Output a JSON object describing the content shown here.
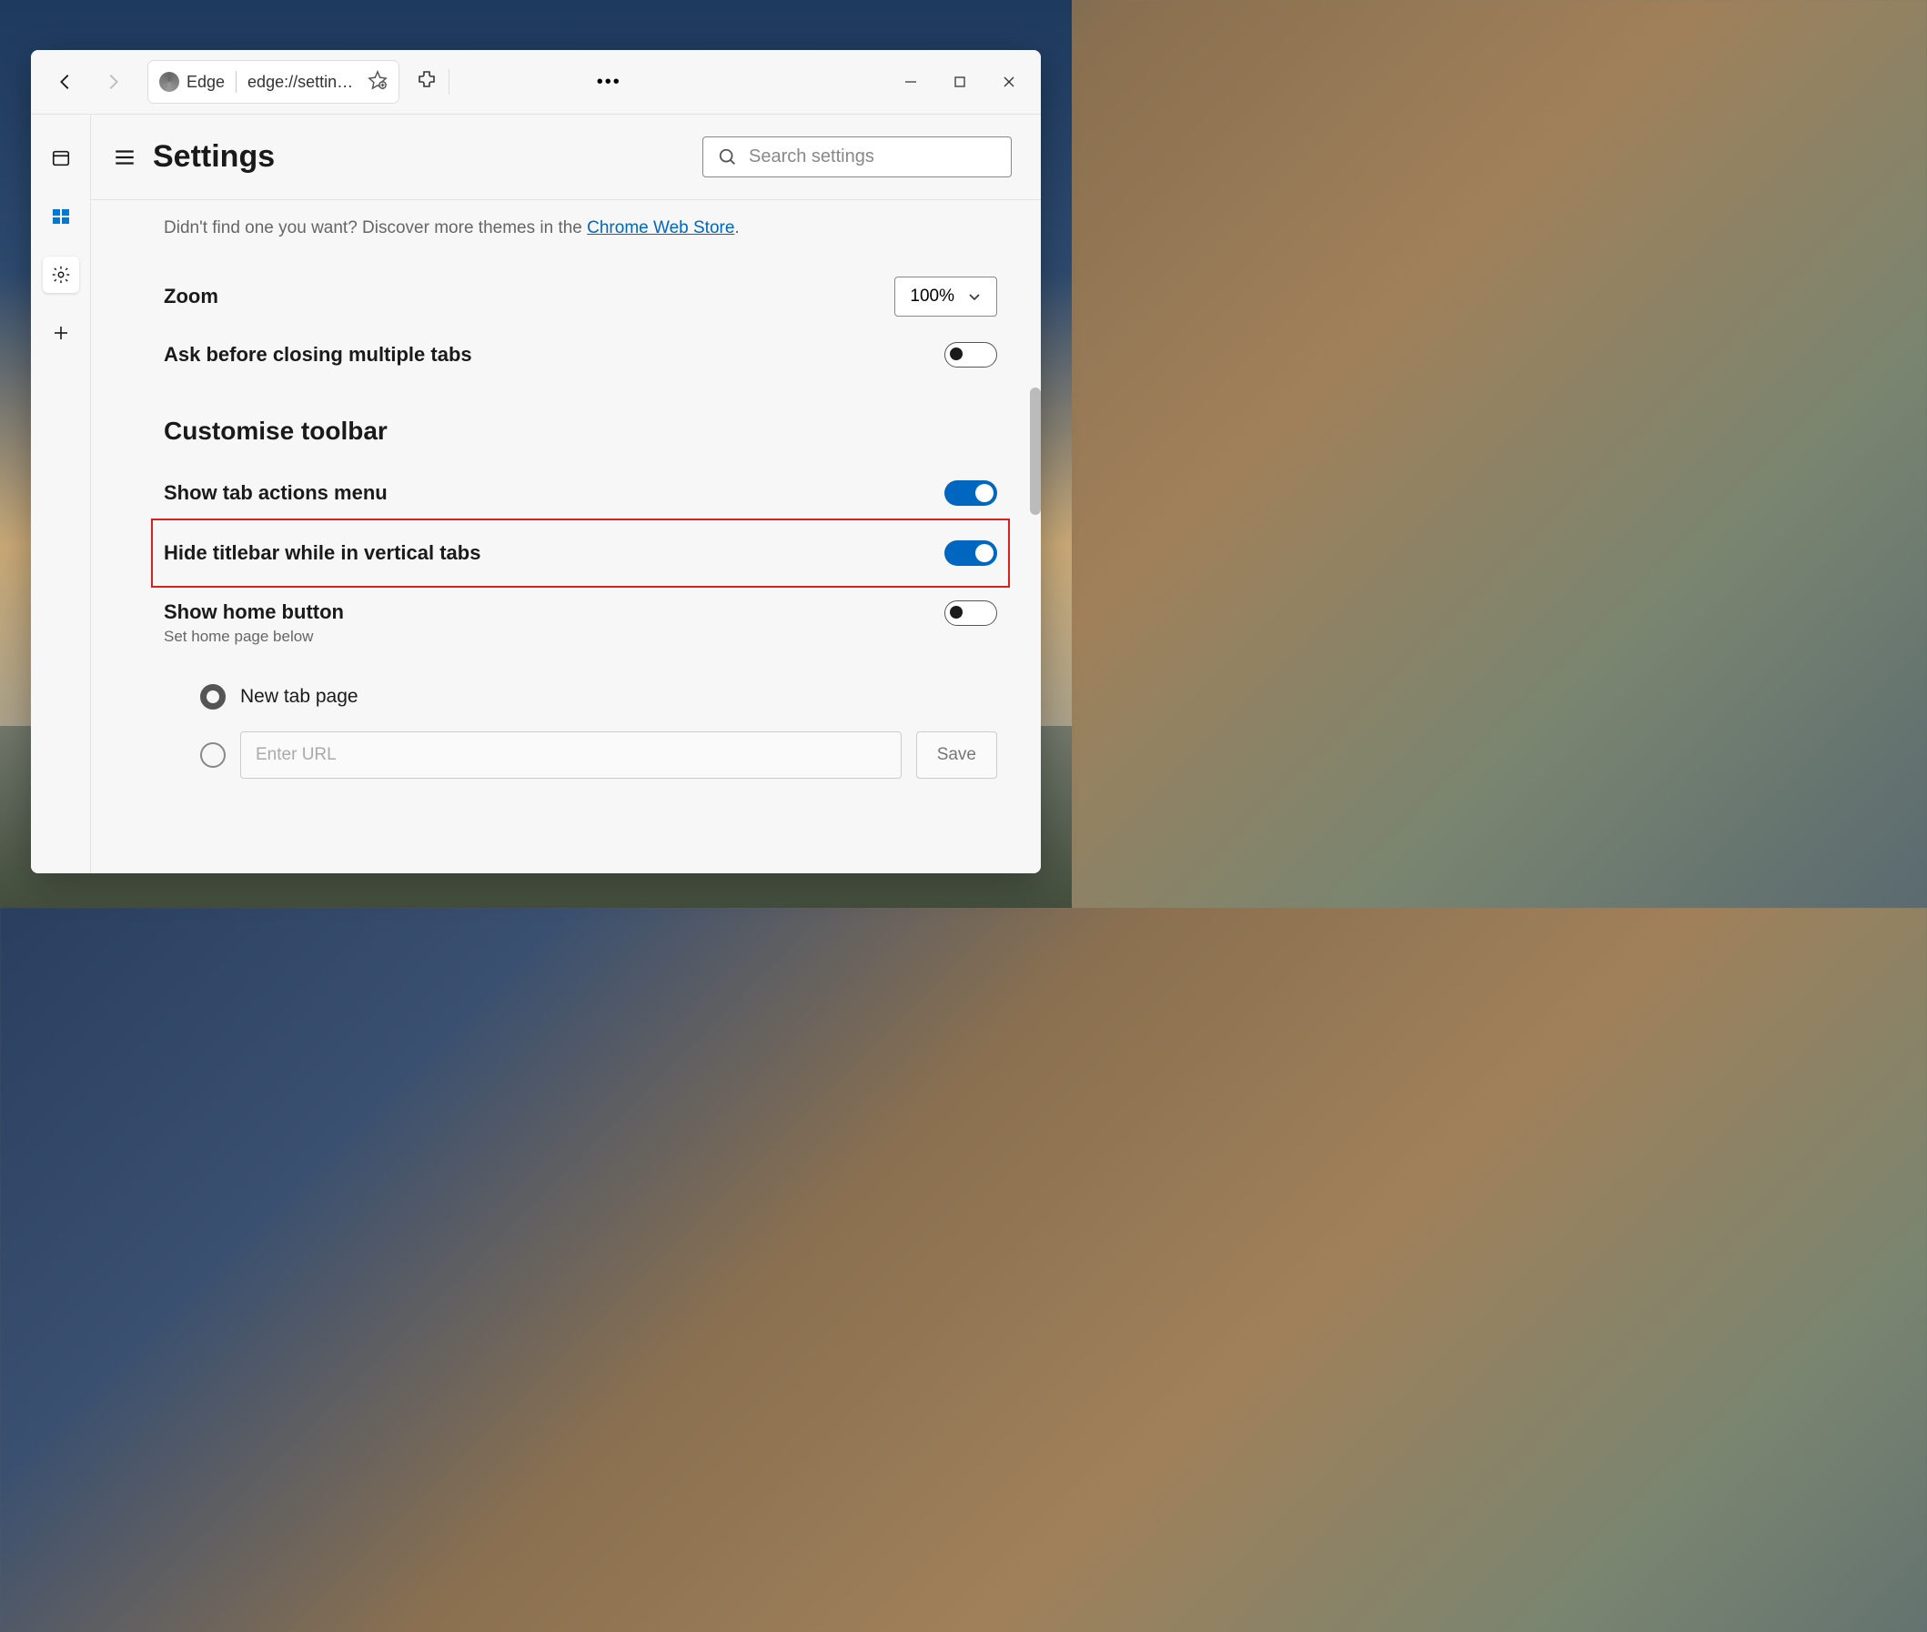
{
  "tab": {
    "app_name": "Edge",
    "url_display": "edge://settin…"
  },
  "header": {
    "title": "Settings",
    "search_placeholder": "Search settings"
  },
  "discover": {
    "prefix": "Didn't find one you want? Discover more themes in the ",
    "link_text": "Chrome Web Store",
    "suffix": "."
  },
  "zoom": {
    "label": "Zoom",
    "value": "100%"
  },
  "ask_close": {
    "label": "Ask before closing multiple tabs",
    "enabled": false
  },
  "section_toolbar": "Customise toolbar",
  "tab_actions": {
    "label": "Show tab actions menu",
    "enabled": true
  },
  "hide_titlebar": {
    "label": "Hide titlebar while in vertical tabs",
    "enabled": true
  },
  "home_button": {
    "label": "Show home button",
    "sublabel": "Set home page below",
    "enabled": false
  },
  "home_options": {
    "new_tab": "New tab page",
    "url_placeholder": "Enter URL",
    "save": "Save"
  }
}
